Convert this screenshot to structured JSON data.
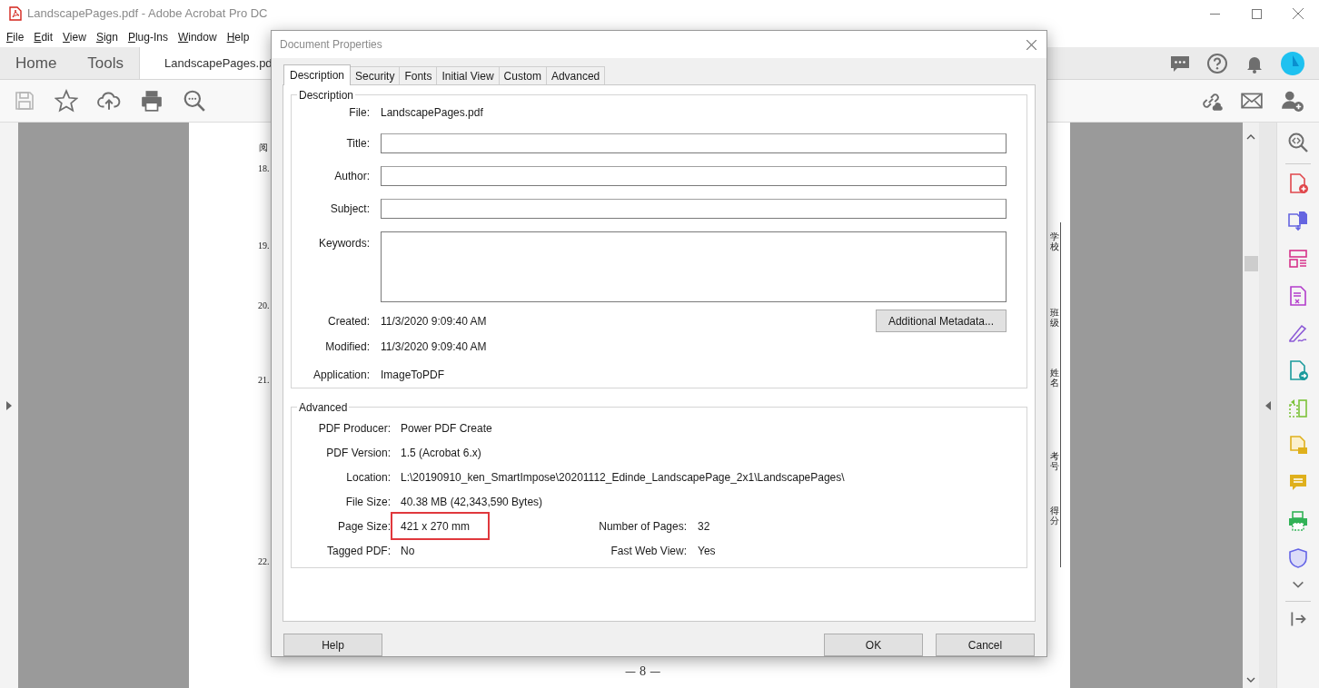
{
  "window": {
    "title": "LandscapePages.pdf - Adobe Acrobat Pro DC"
  },
  "menu": [
    "File",
    "Edit",
    "View",
    "Sign",
    "Plug-Ins",
    "Window",
    "Help"
  ],
  "nav_tabs": [
    {
      "label": "Home",
      "selected": false
    },
    {
      "label": "Tools",
      "selected": false
    },
    {
      "label": "LandscapePages.pd",
      "selected": true
    }
  ],
  "document": {
    "header": "阅",
    "questions": [
      "18.",
      "19.",
      "20.",
      "21.",
      "22."
    ],
    "side_labels": [
      "学校",
      "班级",
      "姓名",
      "考号",
      "得分"
    ],
    "page_number": "— 8 —"
  },
  "dialog": {
    "title": "Document Properties",
    "tabs": [
      {
        "label": "Description",
        "selected": true
      },
      {
        "label": "Security",
        "selected": false
      },
      {
        "label": "Fonts",
        "selected": false
      },
      {
        "label": "Initial View",
        "selected": false
      },
      {
        "label": "Custom",
        "selected": false
      },
      {
        "label": "Advanced",
        "selected": false
      }
    ],
    "description": {
      "legend": "Description",
      "file_label": "File:",
      "file": "LandscapePages.pdf",
      "fields": [
        {
          "label": "Title:",
          "kind": "line"
        },
        {
          "label": "Author:",
          "kind": "line"
        },
        {
          "label": "Subject:",
          "kind": "line"
        },
        {
          "label": "Keywords:",
          "kind": "area"
        }
      ],
      "dates": [
        {
          "label": "Created:",
          "value": "11/3/2020 9:09:40 AM"
        },
        {
          "label": "Modified:",
          "value": "11/3/2020 9:09:40 AM"
        },
        {
          "label": "Application:",
          "value": "ImageToPDF"
        }
      ],
      "metadata_button": "Additional Metadata..."
    },
    "advanced": {
      "legend": "Advanced",
      "rows": [
        {
          "label": "PDF Producer:",
          "value": "Power PDF Create",
          "highlighted": false
        },
        {
          "label": "PDF Version:",
          "value": "1.5 (Acrobat 6.x)",
          "highlighted": false
        },
        {
          "label": "Location:",
          "value": "L:\\20190910_ken_SmartImpose\\20201112_Edinde_LandscapePage_2x1\\LandscapePages\\",
          "highlighted": false
        },
        {
          "label": "File Size:",
          "value": "40.38 MB (42,343,590 Bytes)",
          "highlighted": false
        },
        {
          "label": "Page Size:",
          "value": "421 x 270 mm",
          "highlighted": true,
          "extra_label": "Number of Pages:",
          "extra_value": "32"
        },
        {
          "label": "Tagged PDF:",
          "value": "No",
          "highlighted": false,
          "extra_label": "Fast Web View:",
          "extra_value": "Yes"
        }
      ]
    },
    "buttons": {
      "help": "Help",
      "ok": "OK",
      "cancel": "Cancel"
    }
  }
}
